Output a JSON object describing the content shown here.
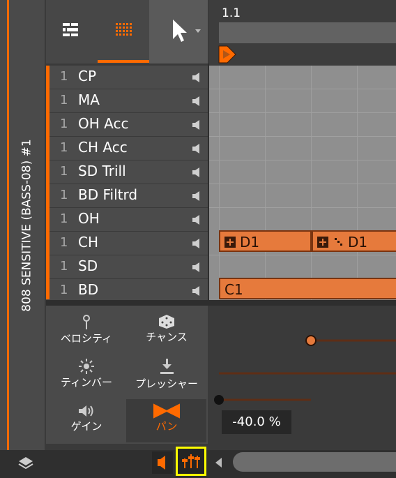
{
  "track": {
    "name": "808 SENSITIVE (BASS-08) #1"
  },
  "ruler": {
    "position": "1.1"
  },
  "lanes": [
    {
      "num": "1",
      "name": "CP"
    },
    {
      "num": "1",
      "name": "MA"
    },
    {
      "num": "1",
      "name": "OH Acc"
    },
    {
      "num": "1",
      "name": "CH Acc"
    },
    {
      "num": "1",
      "name": "SD Trill"
    },
    {
      "num": "1",
      "name": "BD Filtrd"
    },
    {
      "num": "1",
      "name": "OH"
    },
    {
      "num": "1",
      "name": "CH"
    },
    {
      "num": "1",
      "name": "SD"
    },
    {
      "num": "1",
      "name": "BD"
    }
  ],
  "notes": {
    "ch_note_1": "D1",
    "ch_note_2": "D1",
    "bd_note": "C1"
  },
  "expressions": {
    "velocity": "ベロシティ",
    "chance": "チャンス",
    "timbre": "ティンバー",
    "pressure": "プレッシャー",
    "gain": "ゲイン",
    "pan": "パン"
  },
  "automation": {
    "value": "-40.0 %",
    "pan_level": -0.4
  },
  "colors": {
    "accent": "#ff6a00",
    "note": "#e67a3c",
    "highlight": "#ffff00"
  },
  "icons": [
    "list-view-icon",
    "grid-view-icon",
    "pointer-tool-icon",
    "speaker-icon",
    "layers-icon",
    "mixer-icon",
    "scroll-left-icon"
  ]
}
